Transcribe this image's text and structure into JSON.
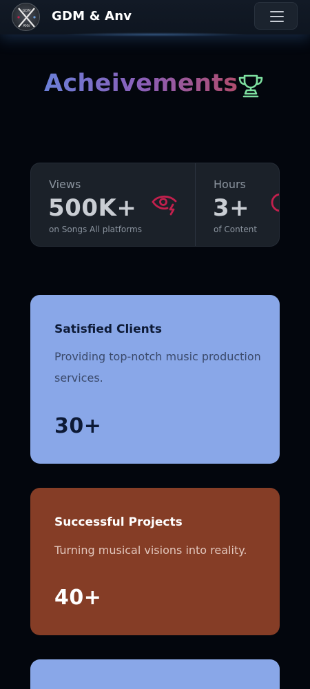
{
  "header": {
    "brand": "GDM & Anv",
    "logo_text_top": "GDM",
    "logo_text_bottom": "ANV",
    "menu_icon": "hamburger-icon"
  },
  "hero": {
    "title": "Acheivements",
    "icon": "trophy-icon"
  },
  "stats": [
    {
      "label": "Views",
      "value": "500K+",
      "sub": "on Songs All platforms",
      "icon": "eye-icon"
    },
    {
      "label": "Hours",
      "value": "3+",
      "sub": "of Content",
      "icon": "clock-icon"
    }
  ],
  "cards": [
    {
      "title": "Satisfied Clients",
      "description": "Providing top-notch music production services.",
      "value": "30+"
    },
    {
      "title": "Successful Projects",
      "description": "Turning musical visions into reality.",
      "value": "40+"
    }
  ],
  "colors": {
    "background": "#03060d",
    "accent_red": "#c2204d",
    "trophy_green": "#7ee0a0",
    "card_blue": "#89a7e8",
    "card_brown": "#853d26"
  }
}
